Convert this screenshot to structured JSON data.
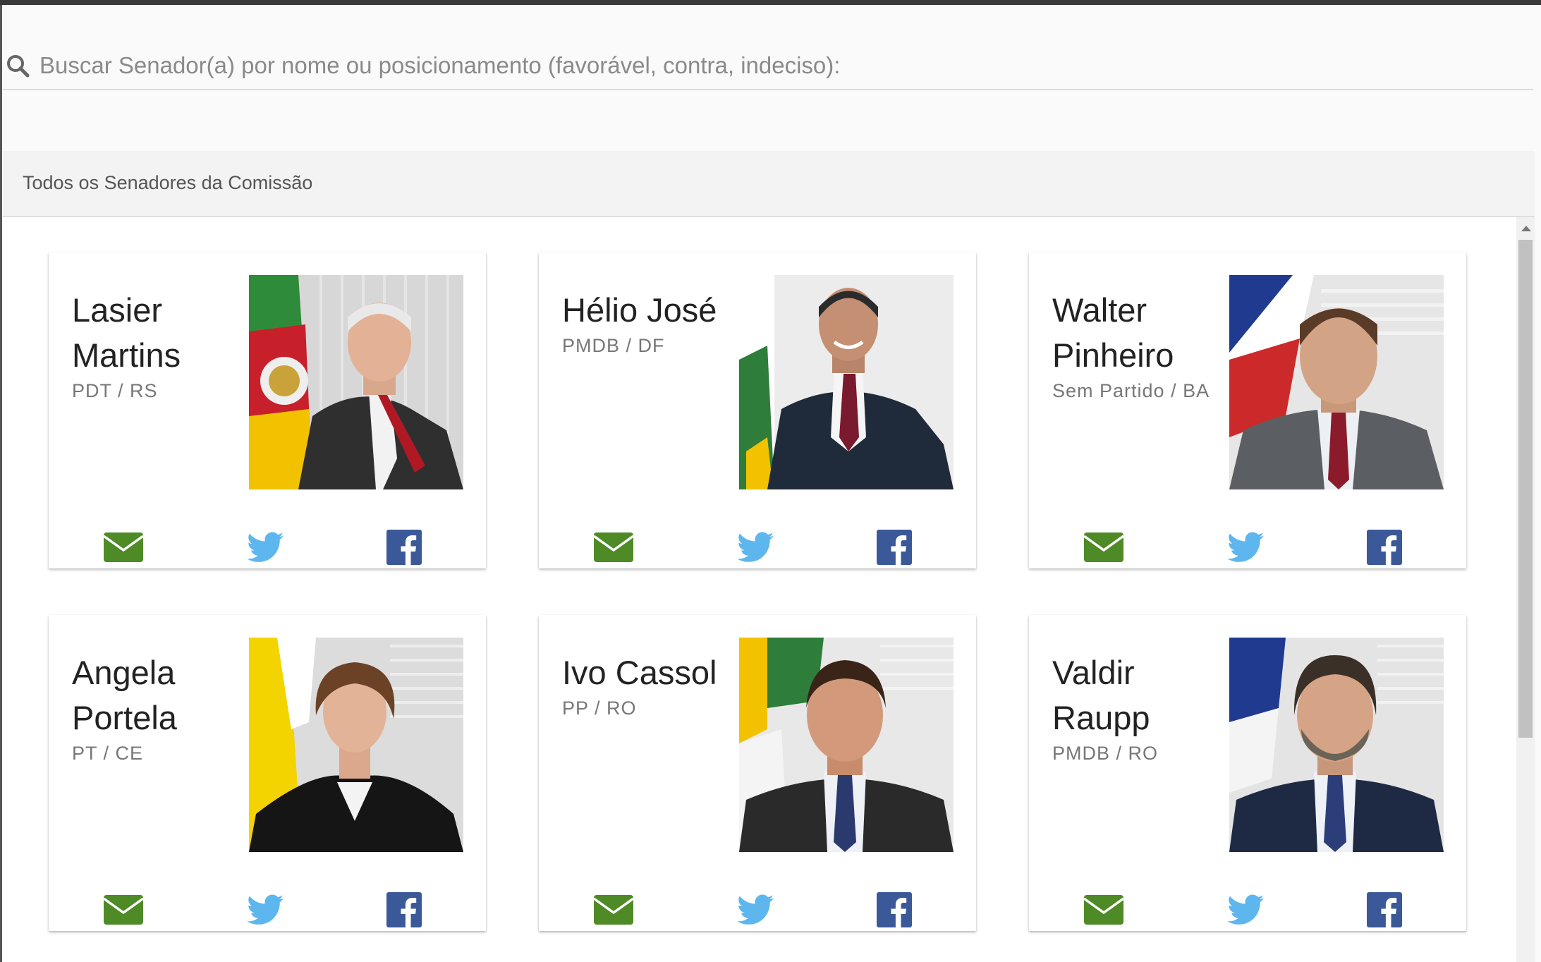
{
  "search": {
    "placeholder": "Buscar Senador(a) por nome ou posicionamento (favorável, contra, indeciso):"
  },
  "section": {
    "title": "Todos os Senadores da Comissão"
  },
  "colors": {
    "mail_icon": "#4e8a26",
    "twitter_icon": "#5eb6ee",
    "facebook_icon": "#3b5998"
  },
  "senators": [
    {
      "name": "Lasier Martins",
      "party": "PDT / RS"
    },
    {
      "name": "Hélio José",
      "party": "PMDB / DF"
    },
    {
      "name": "Walter Pinheiro",
      "party": "Sem Partido / BA"
    },
    {
      "name": "Angela Portela",
      "party": "PT / CE"
    },
    {
      "name": "Ivo Cassol",
      "party": "PP / RO"
    },
    {
      "name": "Valdir Raupp",
      "party": "PMDB / RO"
    }
  ]
}
